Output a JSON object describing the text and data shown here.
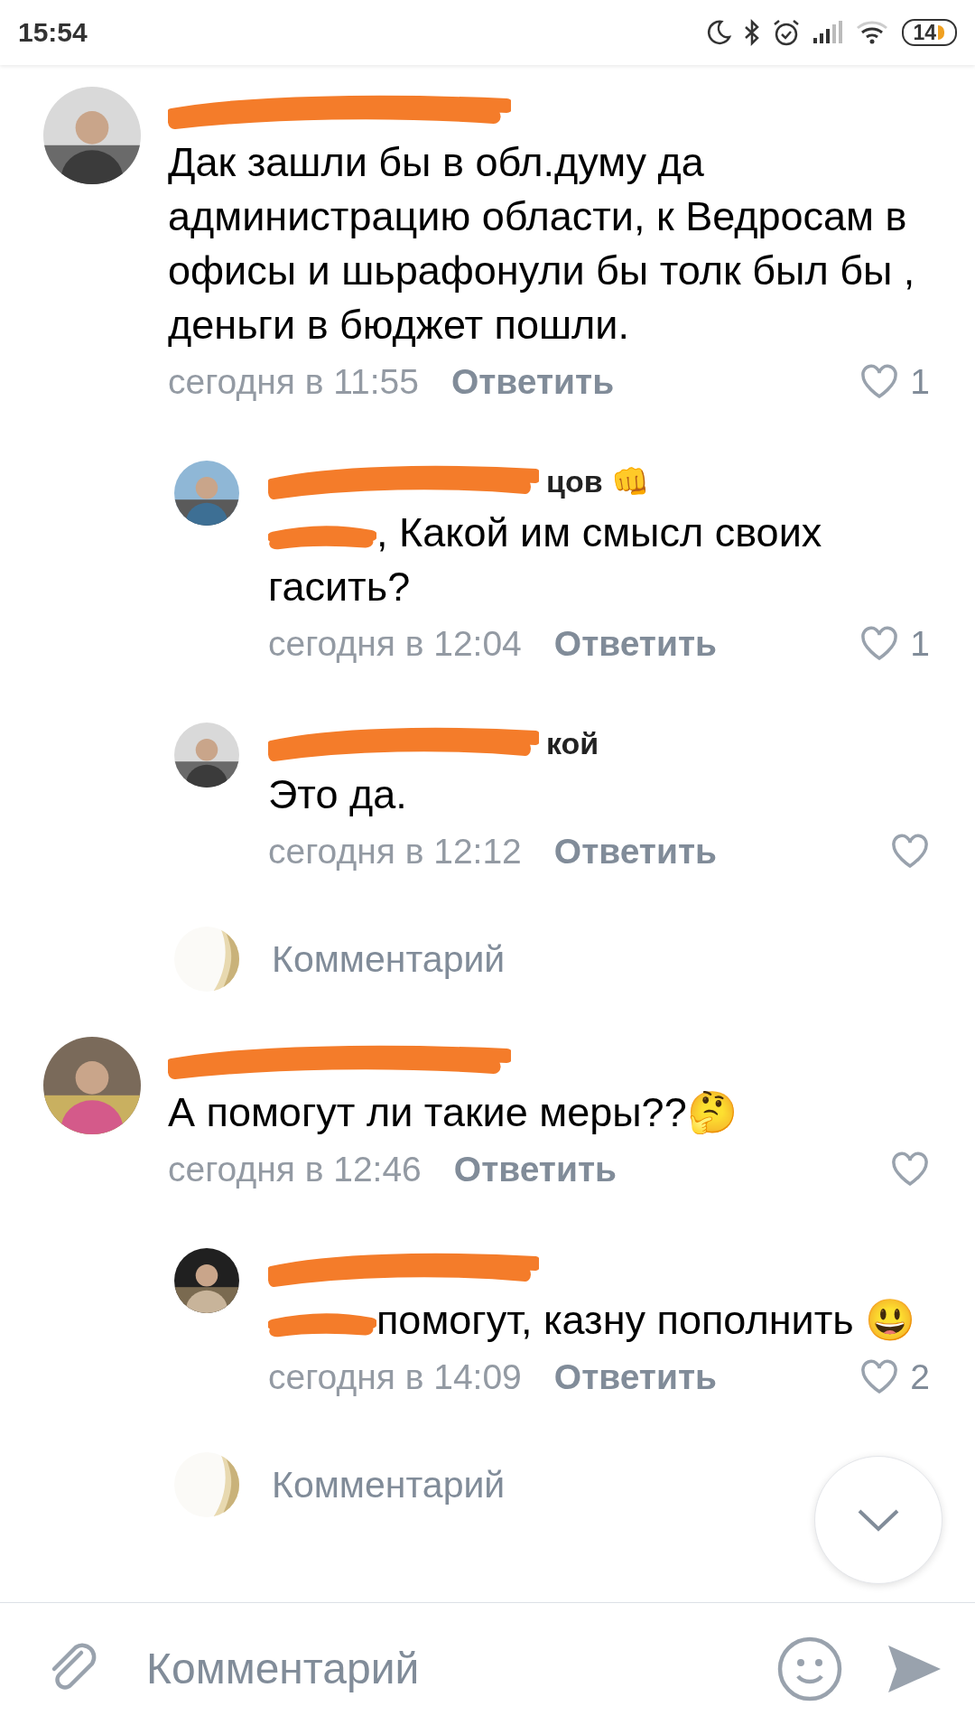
{
  "status_bar": {
    "time": "15:54",
    "battery": "14"
  },
  "items": [
    {
      "kind": "comment",
      "body": "Дак зашли бы в обл.думу да администрацию области, к Ведросам в офисы и шьрафонули бы толк был бы , деньги в бюджет пошли.",
      "mention_redacted": false,
      "time": "сегодня в 11:55",
      "reply": "Ответить",
      "likes": "1"
    },
    {
      "kind": "reply",
      "author_fragment": "цов 👊",
      "body": ", Какой им смысл своих гасить?",
      "mention_redacted": true,
      "time": "сегодня в 12:04",
      "reply": "Ответить",
      "likes": "1"
    },
    {
      "kind": "reply",
      "author_fragment": "кой",
      "body": "Это да.",
      "mention_redacted": false,
      "time": "сегодня в 12:12",
      "reply": "Ответить"
    },
    {
      "kind": "composer",
      "placeholder": "Комментарий"
    },
    {
      "kind": "comment",
      "body": "А помогут ли такие меры??🤔",
      "mention_redacted": false,
      "time": "сегодня в 12:46",
      "reply": "Ответить"
    },
    {
      "kind": "reply",
      "body": "помогут, казну пополнить 😃",
      "mention_redacted": true,
      "time": "сегодня в 14:09",
      "reply": "Ответить",
      "likes": "2"
    },
    {
      "kind": "composer",
      "placeholder": "Комментарий"
    }
  ],
  "input": {
    "placeholder": "Комментарий"
  }
}
